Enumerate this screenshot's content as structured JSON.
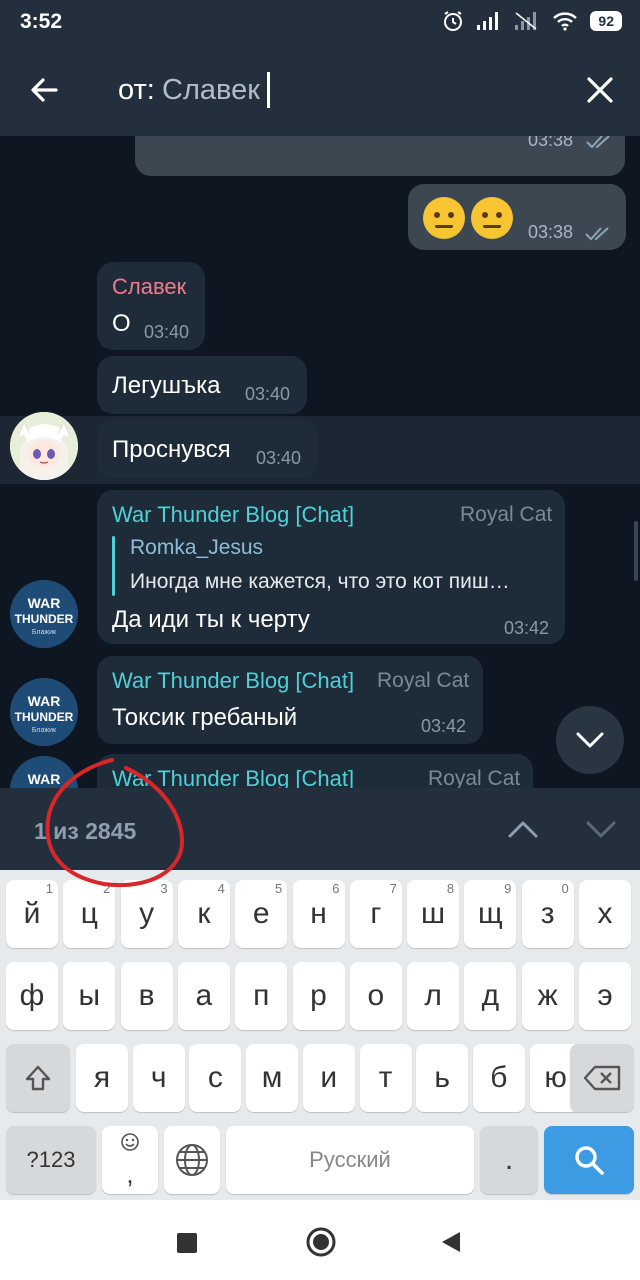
{
  "status": {
    "time": "3:52",
    "battery": "92"
  },
  "search": {
    "prefix": "от:",
    "query": "Славек"
  },
  "messages": {
    "m1": {
      "time": "03:38"
    },
    "m2": {
      "text": "😐😐",
      "time": "03:38"
    },
    "m3": {
      "sender": "Славек",
      "text": "О",
      "time": "03:40"
    },
    "m4": {
      "text": "Легушъка",
      "time": "03:40"
    },
    "m5": {
      "text": "Проснувся",
      "time": "03:40"
    },
    "m6": {
      "chat": "War Thunder Blog [Chat]",
      "author": "Royal Cat",
      "reply_name": "Romka_Jesus",
      "reply_text": "Иногда мне кажется, что это кот пиш…",
      "text": "Да иди ты к черту",
      "time": "03:42"
    },
    "m7": {
      "chat": "War Thunder Blog [Chat]",
      "author": "Royal Cat",
      "text": "Токсик гребаный",
      "time": "03:42"
    },
    "m8": {
      "chat": "War Thunder Blog [Chat]",
      "author": "Royal Cat"
    }
  },
  "avatar_wt": {
    "line1": "WAR",
    "line2": "THUNDER",
    "line3": "Блажик"
  },
  "search_nav": {
    "count": "1 из 2845"
  },
  "keyboard": {
    "row1": [
      {
        "k": "й",
        "n": "1"
      },
      {
        "k": "ц",
        "n": "2"
      },
      {
        "k": "у",
        "n": "3"
      },
      {
        "k": "к",
        "n": "4"
      },
      {
        "k": "е",
        "n": "5"
      },
      {
        "k": "н",
        "n": "6"
      },
      {
        "k": "г",
        "n": "7"
      },
      {
        "k": "ш",
        "n": "8"
      },
      {
        "k": "щ",
        "n": "9"
      },
      {
        "k": "з",
        "n": "0"
      },
      {
        "k": "х",
        "n": ""
      }
    ],
    "row2": [
      "ф",
      "ы",
      "в",
      "а",
      "п",
      "р",
      "о",
      "л",
      "д",
      "ж",
      "э"
    ],
    "row3": [
      "я",
      "ч",
      "с",
      "м",
      "и",
      "т",
      "ь",
      "б",
      "ю"
    ],
    "sym_label": "?123",
    "comma": ",",
    "space_label": "Русский",
    "period": "."
  },
  "colors": {
    "accent_teal": "#4fd0d6",
    "sender_red": "#f07b8c",
    "enter_blue": "#3d9be3",
    "annotation_red": "#d8262b"
  }
}
